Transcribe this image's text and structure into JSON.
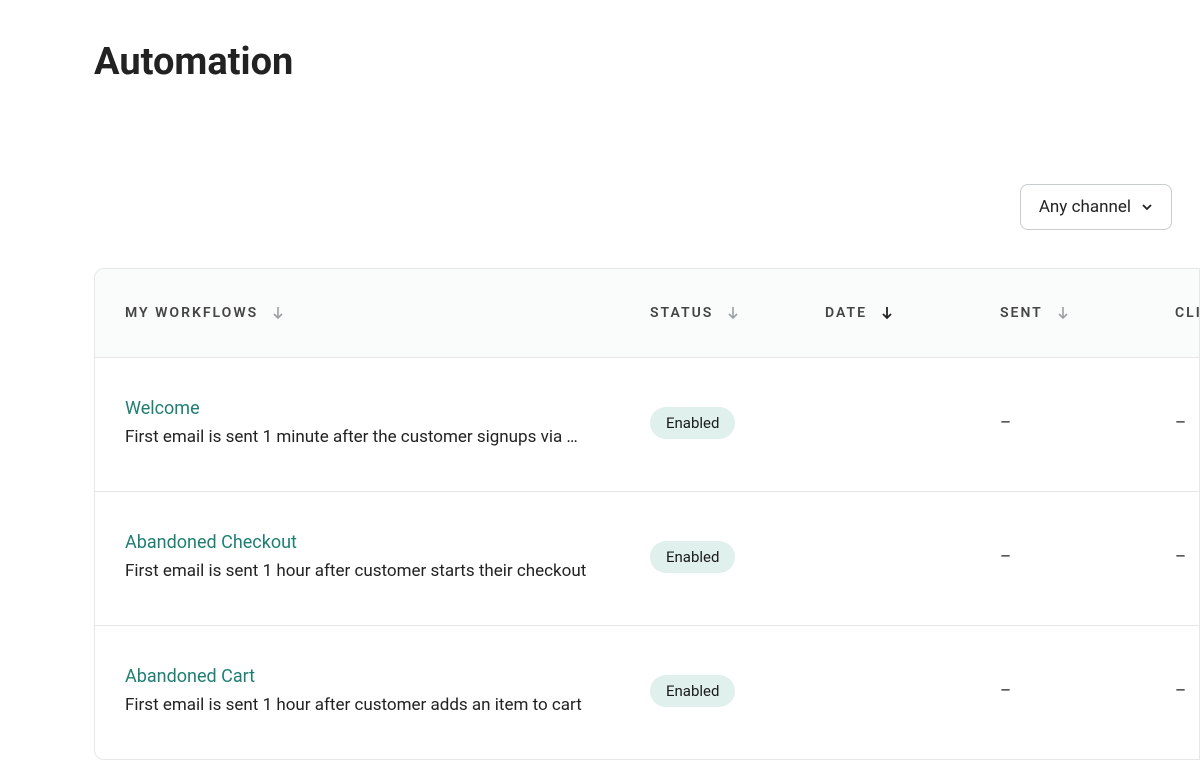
{
  "page_title": "Automation",
  "filter": {
    "channel_label": "Any channel"
  },
  "table": {
    "columns": {
      "workflows": "MY WORKFLOWS",
      "status": "STATUS",
      "date": "DATE",
      "sent": "SENT",
      "click": "CLI"
    },
    "rows": [
      {
        "name": "Welcome",
        "description": "First email is sent 1 minute after the customer signups via …",
        "status": "Enabled",
        "date": "",
        "sent": "–",
        "click": "–"
      },
      {
        "name": "Abandoned Checkout",
        "description": "First email is sent 1 hour after customer starts their checkout",
        "status": "Enabled",
        "date": "",
        "sent": "–",
        "click": "–"
      },
      {
        "name": "Abandoned Cart",
        "description": "First email is sent 1 hour after customer adds an item to cart",
        "status": "Enabled",
        "date": "",
        "sent": "–",
        "click": "–"
      }
    ]
  }
}
